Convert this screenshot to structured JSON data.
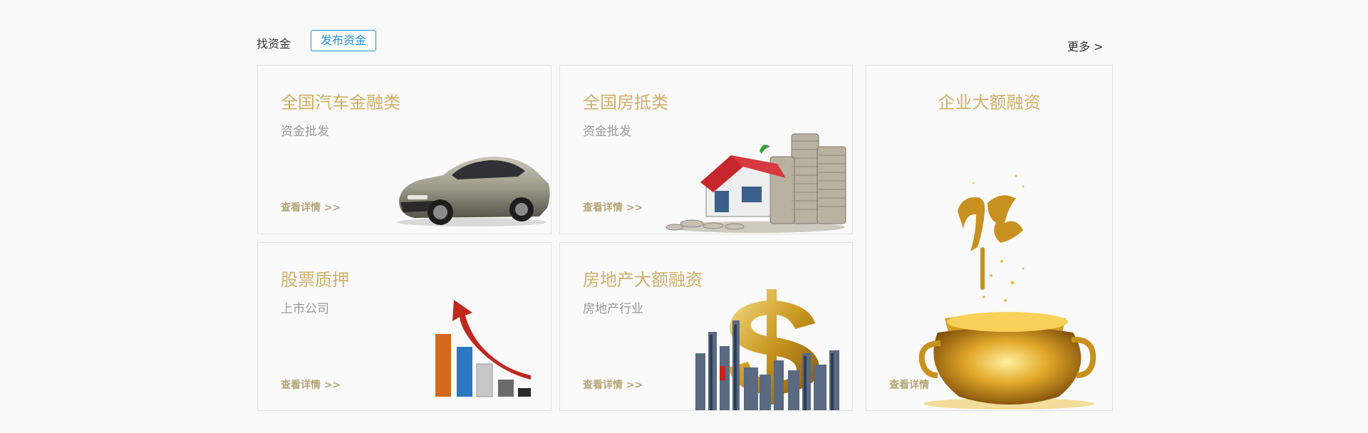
{
  "header": {
    "find_label": "找资金",
    "publish_label": "发布资金",
    "more_label": "更多 >"
  },
  "cards": [
    {
      "title": "全国汽车金融类",
      "subtitle": "资金批发",
      "link": "查看详情 >>",
      "image": "sports-car"
    },
    {
      "title": "全国房抵类",
      "subtitle": "资金批发",
      "link": "查看详情 >>",
      "image": "house-with-coin-stacks"
    },
    {
      "title": "企业大额融资",
      "subtitle": "",
      "link": "查看详情",
      "image": "golden-treasure-pot"
    },
    {
      "title": "股票质押",
      "subtitle": "上市公司",
      "link": "查看详情 >>",
      "image": "rising-bar-chart-arrow"
    },
    {
      "title": "房地产大额融资",
      "subtitle": "房地产行业",
      "link": "查看详情 >>",
      "image": "dollar-sign-city-skyline"
    }
  ],
  "colors": {
    "accent_blue": "#1e8fd6",
    "title_gold": "#d0b06a",
    "link_gold": "#b5a577",
    "background": "#f9f9f9"
  }
}
